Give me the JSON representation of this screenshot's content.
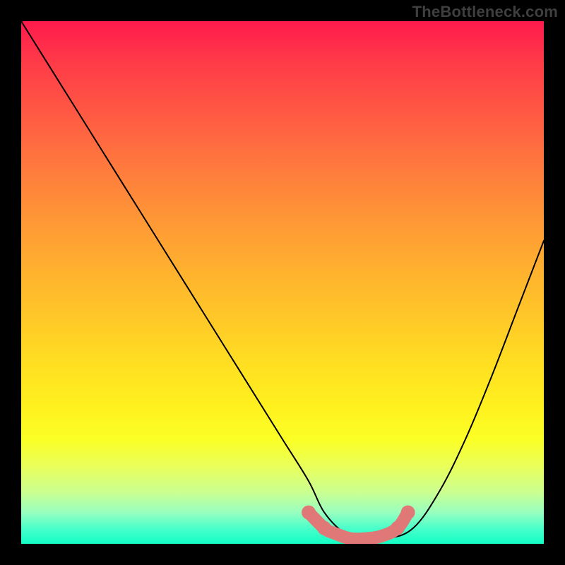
{
  "watermark": "TheBottleneck.com",
  "chart_data": {
    "type": "line",
    "title": "",
    "xlabel": "",
    "ylabel": "",
    "xlim": [
      0,
      100
    ],
    "ylim": [
      0,
      100
    ],
    "grid": false,
    "legend": false,
    "series": [
      {
        "name": "bottleneck-curve",
        "color": "#000000",
        "x": [
          0,
          5,
          10,
          15,
          20,
          25,
          30,
          35,
          40,
          45,
          50,
          55,
          58,
          62,
          66,
          70,
          75,
          80,
          85,
          90,
          95,
          100
        ],
        "y": [
          100,
          92,
          84,
          76,
          68,
          60,
          52,
          44,
          36,
          28,
          20,
          12,
          6,
          2,
          1,
          1,
          3,
          10,
          20,
          32,
          45,
          58
        ]
      }
    ],
    "highlight": {
      "name": "optimal-zone-marker",
      "color": "#e07878",
      "x": [
        55,
        58,
        60,
        63,
        66,
        69,
        72,
        74
      ],
      "y": [
        6,
        3,
        2,
        1,
        1,
        1.5,
        3,
        6
      ]
    },
    "background_gradient": {
      "top": "#ff1a4c",
      "mid": "#ffe021",
      "bottom": "#12ffc6"
    }
  }
}
